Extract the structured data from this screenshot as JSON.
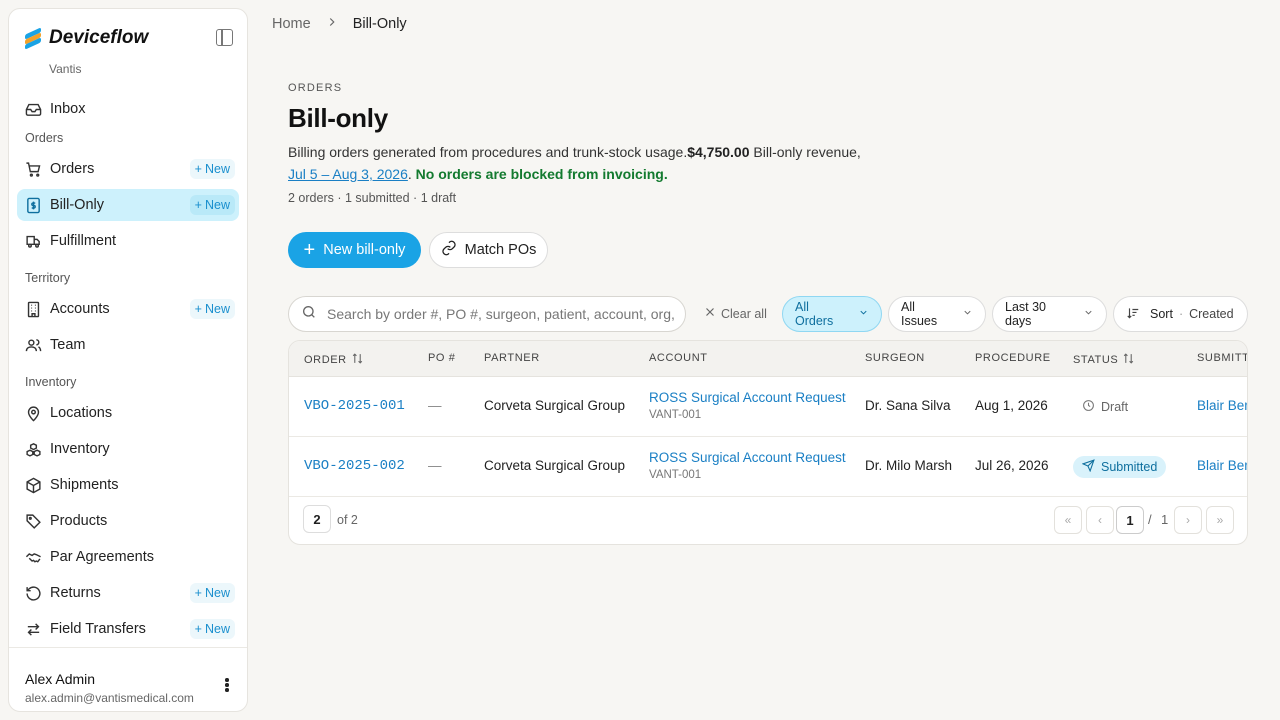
{
  "app": {
    "name": "Deviceflow",
    "org": "Vantis"
  },
  "sidebar": {
    "inbox": "Inbox",
    "sections": {
      "orders": "Orders",
      "territory": "Territory",
      "inventory": "Inventory"
    },
    "new_label": "New",
    "items": {
      "orders": "Orders",
      "bill_only": "Bill-Only",
      "fulfillment": "Fulfillment",
      "accounts": "Accounts",
      "team": "Team",
      "locations": "Locations",
      "inventory": "Inventory",
      "shipments": "Shipments",
      "products": "Products",
      "par_agreements": "Par Agreements",
      "returns": "Returns",
      "field_transfers": "Field Transfers"
    },
    "user": {
      "name": "Alex Admin",
      "email": "alex.admin@vantismedical.com"
    }
  },
  "breadcrumb": {
    "home": "Home",
    "current": "Bill-Only"
  },
  "page": {
    "eyebrow": "ORDERS",
    "title": "Bill-only",
    "desc_text": "Billing orders generated from procedures and trunk-stock usage.",
    "revenue_amount": "$4,750.00",
    "revenue_label": " Bill-only revenue,",
    "date_range": "Jul 5 – Aug 3, 2026",
    "period": ". ",
    "blocked_note": "No orders are blocked from invoicing.",
    "counts": "2 orders · 1 submitted · 1 draft"
  },
  "actions": {
    "new": "New bill-only",
    "match": "Match POs"
  },
  "filters": {
    "search_placeholder": "Search by order #, PO #, surgeon, patient, account, org, or",
    "clear_all": "Clear all",
    "orders": "All Orders",
    "issues": "All Issues",
    "range": "Last 30 days",
    "sort": "Sort",
    "sort_sep": "·",
    "sort_field": "Created"
  },
  "table": {
    "headers": {
      "order": "ORDER",
      "po": "PO #",
      "partner": "PARTNER",
      "account": "ACCOUNT",
      "surgeon": "SURGEON",
      "procedure": "PROCEDURE",
      "status": "STATUS",
      "submitted": "SUBMITTED BY"
    },
    "rows": [
      {
        "order": "VBO-2025-001",
        "po": "—",
        "partner": "Corveta Surgical Group",
        "account": "ROSS Surgical Account Request",
        "account_code": "VANT-001",
        "surgeon": "Dr. Sana Silva",
        "procedure": "Aug 1, 2026",
        "status": "Draft",
        "submitted": "Blair Bennett"
      },
      {
        "order": "VBO-2025-002",
        "po": "—",
        "partner": "Corveta Surgical Group",
        "account": "ROSS Surgical Account Request",
        "account_code": "VANT-001",
        "surgeon": "Dr. Milo Marsh",
        "procedure": "Jul 26, 2026",
        "status": "Submitted",
        "submitted": "Blair Bennett"
      }
    ],
    "footer": {
      "count": "2",
      "of": "of 2",
      "page": "1",
      "sep": "/",
      "total": "1"
    }
  }
}
